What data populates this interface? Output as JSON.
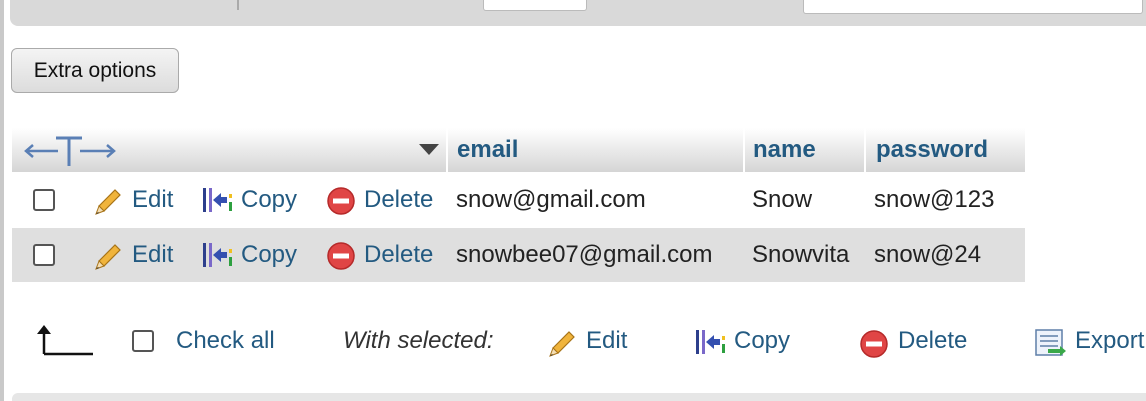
{
  "toolbar": {
    "extra_options_label": "Extra options"
  },
  "table": {
    "columns": [
      "email",
      "name",
      "password"
    ],
    "row_actions": {
      "edit": "Edit",
      "copy": "Copy",
      "delete": "Delete"
    },
    "rows": [
      {
        "email": "snow@gmail.com",
        "name": "Snow",
        "password": "snow@123"
      },
      {
        "email": "snowbee07@gmail.com",
        "name": "Snowvita",
        "password": "snow@24"
      }
    ]
  },
  "bulk": {
    "check_all": "Check all",
    "with_selected": "With selected:",
    "edit": "Edit",
    "copy": "Copy",
    "delete": "Delete",
    "export": "Export"
  },
  "colors": {
    "link": "#235a81",
    "row_alt": "#dfdfdf",
    "delete_red": "#e04545",
    "pencil": "#f0b43c"
  }
}
